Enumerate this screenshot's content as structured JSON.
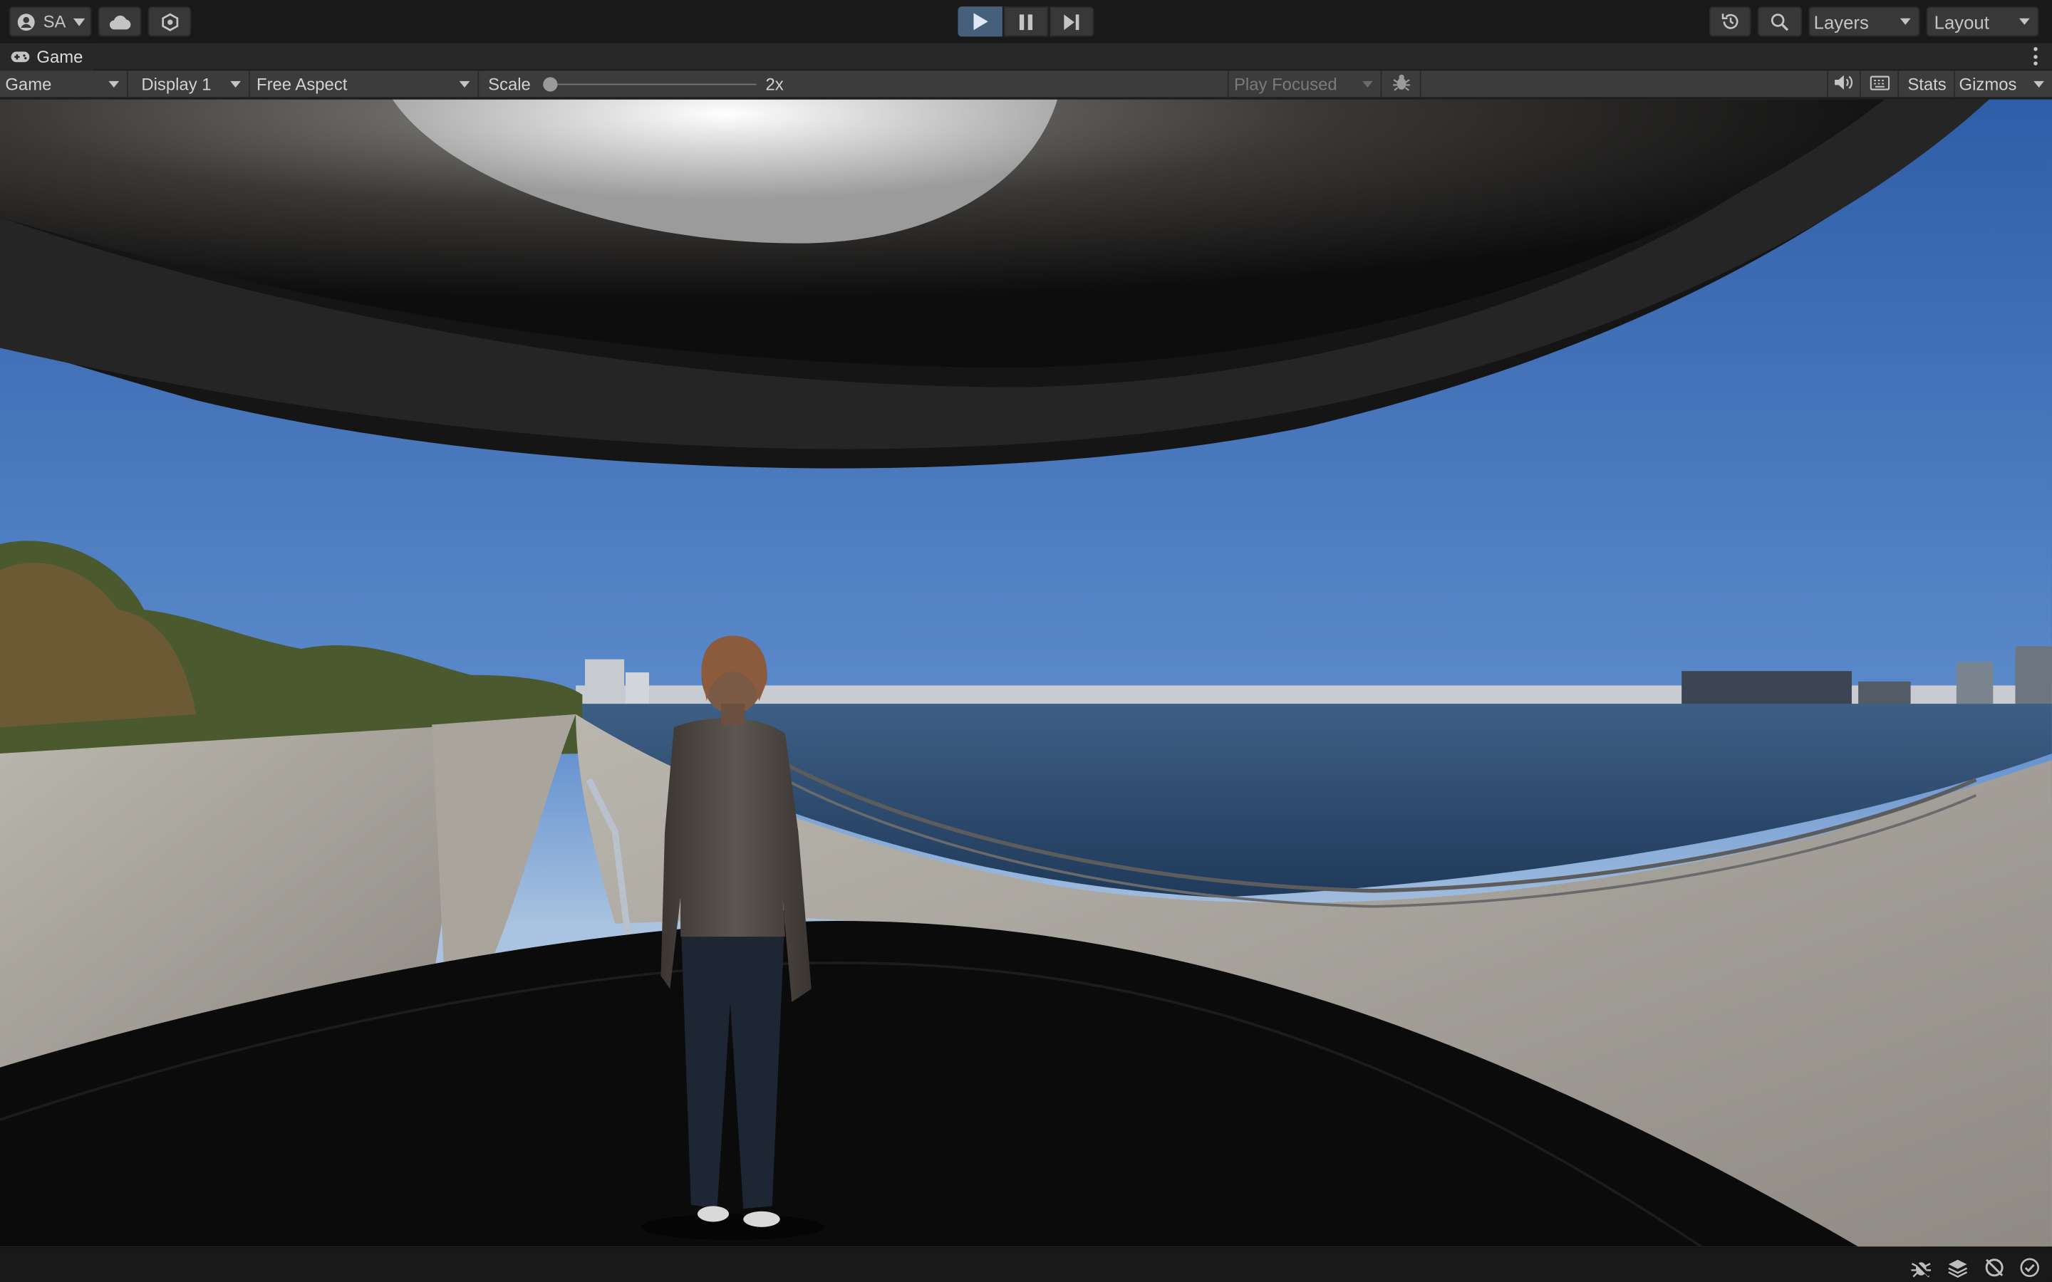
{
  "toolbar": {
    "account_label": "SA",
    "layers_label": "Layers",
    "layout_label": "Layout",
    "play_active": true,
    "accent_color": "#46607c"
  },
  "tab": {
    "title": "Game"
  },
  "game_toolbar": {
    "view_mode": "Game",
    "display": "Display 1",
    "aspect": "Free Aspect",
    "scale_label": "Scale",
    "scale_value": "2x",
    "play_focused": "Play Focused",
    "stats_label": "Stats",
    "gizmos_label": "Gizmos"
  },
  "icons": {
    "account": "account-icon",
    "cloud": "cloud-icon",
    "collab": "collab-icon",
    "play": "play-icon",
    "pause": "pause-icon",
    "step": "step-icon",
    "history": "history-icon",
    "search": "search-icon",
    "gamepad": "gamepad-icon",
    "bug": "bug-icon",
    "audio": "audio-icon",
    "stats": "keyboard-icon",
    "status": [
      "debug-icon",
      "layers-status-icon",
      "progress-icon",
      "check-icon"
    ]
  }
}
